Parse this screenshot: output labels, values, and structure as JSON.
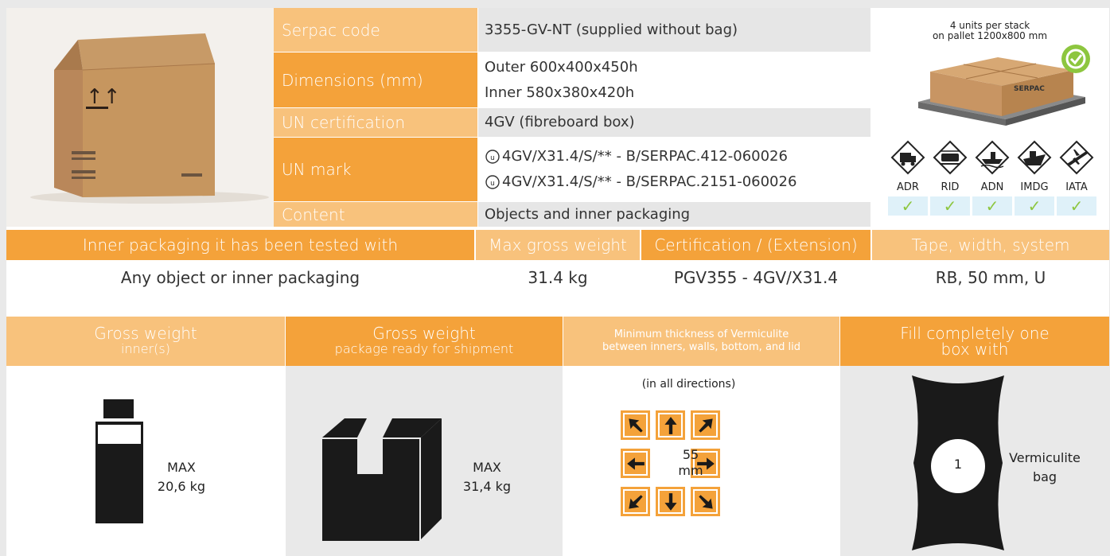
{
  "spec": {
    "serpac_code_label": "Serpac code",
    "serpac_code": "3355-GV-NT (supplied without bag)",
    "dimensions_label": "Dimensions (mm)",
    "outer": "Outer 600x400x450h",
    "inner": "Inner 580x380x420h",
    "un_cert_label": "UN certification",
    "un_cert": "4GV (fibreboard box)",
    "un_mark_label": "UN mark",
    "un_mark_1": "4GV/X31.4/S/** - B/SERPAC.412-060026",
    "un_mark_2": "4GV/X31.4/S/** - B/SERPAC.2151-060026",
    "content_label": "Content",
    "content": "Objects and inner packaging"
  },
  "stack": {
    "caption_line1": "4 units per stack",
    "caption_line2": "on pallet 1200x800 mm",
    "box_brand": "SERPAC",
    "modes": [
      {
        "label": "ADR",
        "check": "✓"
      },
      {
        "label": "RID",
        "check": "✓"
      },
      {
        "label": "ADN",
        "check": "✓"
      },
      {
        "label": "IMDG",
        "check": "✓"
      },
      {
        "label": "IATA",
        "check": "✓"
      }
    ]
  },
  "test": {
    "h_inner": "Inner packaging it has been tested with",
    "h_maxgross": "Max gross weight",
    "h_cert": "Certification / (Extension)",
    "h_tape": "Tape, width, system",
    "v_inner": "Any object or inner packaging",
    "v_maxgross": "31.4 kg",
    "v_cert": "PGV355 - 4GV/X31.4",
    "v_tape": "RB, 50 mm, U"
  },
  "bottom": {
    "gw_inner_title": "Gross weight",
    "gw_inner_sub": "inner(s)",
    "gw_pkg_title": "Gross weight",
    "gw_pkg_sub": "package ready for shipment",
    "verm_line1": "Minimum thickness of Vermiculite",
    "verm_line2": "between inners, walls, bottom, and lid",
    "fill_line1": "Fill completely one",
    "fill_line2": "box with",
    "max_label": "MAX",
    "inner_max": "20,6 kg",
    "pkg_max": "31,4 kg",
    "all_directions": "(in all directions)",
    "thickness_value": "55",
    "thickness_unit": "mm",
    "bag_count": "1",
    "bag_label_1": "Vermiculite",
    "bag_label_2": "bag"
  }
}
